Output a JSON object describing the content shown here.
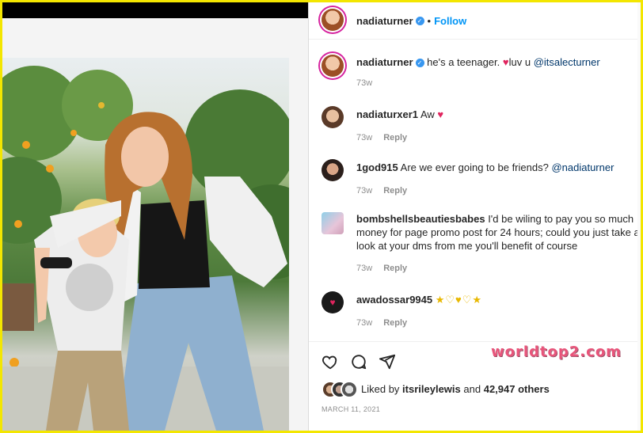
{
  "post": {
    "username": "nadiaturner",
    "follow_label": "Follow",
    "separator": "•"
  },
  "caption": {
    "username": "nadiaturner",
    "text": "he's a teenager.",
    "after_heart": "luv u",
    "mention": "@itsalecturner",
    "time": "73w"
  },
  "comments": [
    {
      "username": "nadiaturxer1",
      "text": "Aw",
      "heart": "♥",
      "time": "73w",
      "reply": "Reply"
    },
    {
      "username": "1god915",
      "text": "Are we ever going to be friends?",
      "mention": "@nadiaturner",
      "time": "73w",
      "reply": "Reply"
    },
    {
      "username": "bombshellsbeautiesbabes",
      "text_line1": "I'd be wiling to pay you so much",
      "text_line2": "money for page promo post for 24 hours; could you just take a",
      "text_line3": "look at your dms from me you'll benefit of course",
      "time": "73w",
      "reply": "Reply"
    },
    {
      "username": "awadossar9945",
      "emojis": "★♡♥♡★",
      "time": "73w",
      "reply": "Reply"
    }
  ],
  "likes": {
    "prefix": "Liked by",
    "user": "itsrileylewis",
    "and": "and",
    "count": "42,947 others"
  },
  "date": "MARCH 11, 2021",
  "watermark": "worldtop2.com",
  "icons": {
    "like": "heart-outline-icon",
    "comment": "comment-bubble-icon",
    "share": "paper-plane-icon",
    "verified": "verified-badge-icon"
  },
  "colors": {
    "accent_blue": "#0095f6",
    "verified_blue": "#3897f0",
    "frame_yellow": "#f3e600",
    "heart_red": "#e0245e"
  }
}
